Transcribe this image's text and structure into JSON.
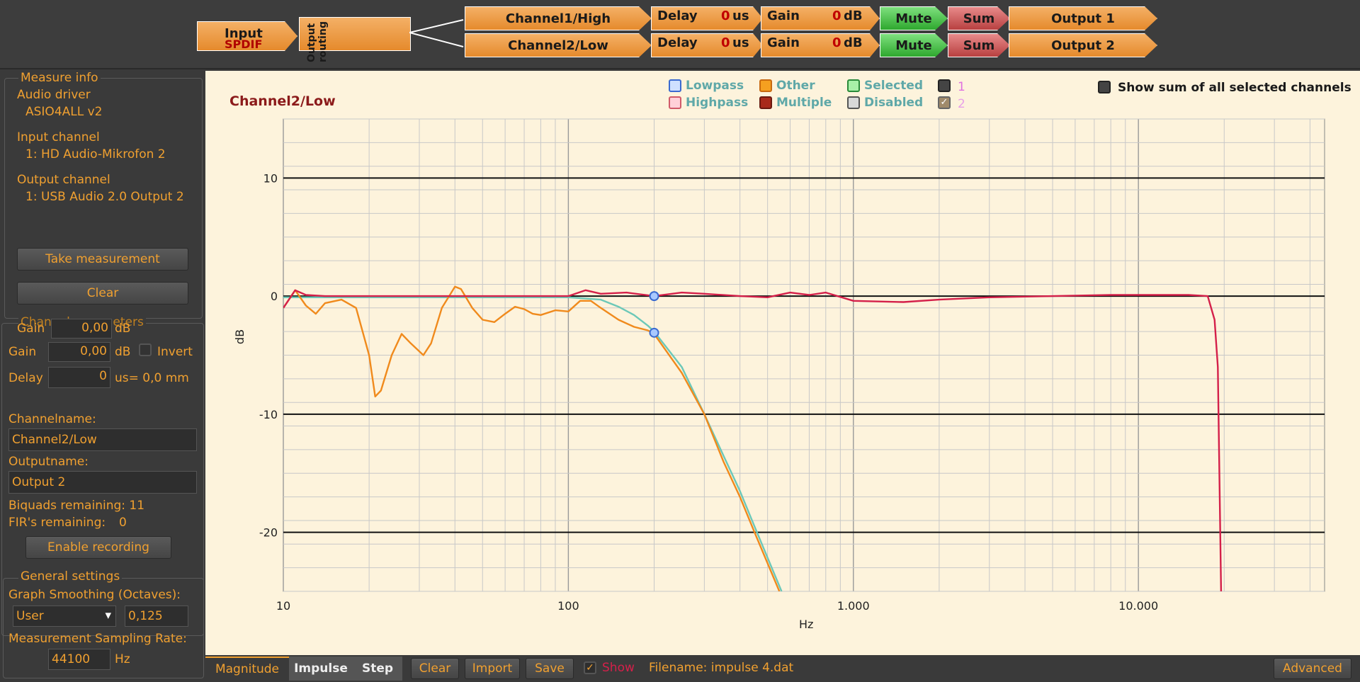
{
  "routing": {
    "input": "Input",
    "input_sub": "SPDIF",
    "output_routing": "Output routing",
    "channels": [
      {
        "name": "Channel1/High",
        "delay_label": "Delay",
        "delay_value": "0",
        "delay_unit": "us",
        "gain_label": "Gain",
        "gain_value": "0",
        "gain_unit": "dB",
        "mute": "Mute",
        "sum": "Sum",
        "output": "Output 1"
      },
      {
        "name": "Channel2/Low",
        "delay_label": "Delay",
        "delay_value": "0",
        "delay_unit": "us",
        "gain_label": "Gain",
        "gain_value": "0",
        "gain_unit": "dB",
        "mute": "Mute",
        "sum": "Sum",
        "output": "Output 2"
      }
    ]
  },
  "measure": {
    "title": "Measure info",
    "driver_label": "Audio driver",
    "driver_value": "ASIO4ALL v2",
    "input_label": "Input channel",
    "input_value": "1: HD Audio-Mikrofon 2",
    "output_label": "Output channel",
    "output_value": "1: USB Audio 2.0 Output 2",
    "take": "Take measurement",
    "clear": "Clear"
  },
  "channel_params": {
    "title": "Channel parameters",
    "gain_label": "Gain",
    "gain_value1": "0,00",
    "gain_value2": "0,00",
    "db": "dB",
    "invert": "Invert",
    "delay_label": "Delay",
    "delay_value": "0",
    "delay_unit": "us= 0,0 mm",
    "channelname_label": "Channelname:",
    "channelname": "Channel2/Low",
    "outputname_label": "Outputname:",
    "outputname": "Output 2",
    "biquads": "Biquads remaining: 11",
    "firs_label": "FIR's remaining:",
    "firs_value": "0",
    "enable_recording": "Enable recording"
  },
  "general": {
    "title": "General settings",
    "smoothing_label": "Graph Smoothing (Octaves):",
    "smoothing_select": "User",
    "smoothing_value": "0,125",
    "rate_label": "Measurement Sampling Rate:",
    "rate_value": "44100",
    "rate_unit": "Hz"
  },
  "legend": {
    "lowpass": "Lowpass",
    "highpass": "Highpass",
    "other": "Other",
    "multiple": "Multiple",
    "selected": "Selected",
    "disabled": "Disabled",
    "one": "1",
    "two": "2",
    "show_sum": "Show sum of all selected channels"
  },
  "colors": {
    "orange": "#f0a030",
    "red_curve": "#d4204a",
    "orange_curve": "#f08a1c",
    "teal_curve": "#6cc8b8"
  },
  "bottom": {
    "magnitude": "Magnitude",
    "impulse": "Impulse",
    "step": "Step",
    "clear": "Clear",
    "import": "Import",
    "save": "Save",
    "show": "Show",
    "filename": "Filename: impulse 4.dat",
    "advanced": "Advanced"
  },
  "chart_data": {
    "type": "line",
    "title": "Channel2/Low",
    "xlabel": "Hz",
    "ylabel": "dB",
    "xscale": "log",
    "xlim": [
      10,
      45000
    ],
    "ylim": [
      -25,
      15
    ],
    "xticks": [
      {
        "v": 10,
        "label": "10"
      },
      {
        "v": 100,
        "label": "100"
      },
      {
        "v": 1000,
        "label": "1.000"
      },
      {
        "v": 10000,
        "label": "10.000"
      }
    ],
    "yticks": [
      {
        "v": 10,
        "label": "10"
      },
      {
        "v": 0,
        "label": "0"
      },
      {
        "v": -10,
        "label": "-10"
      },
      {
        "v": -20,
        "label": "-20"
      }
    ],
    "series": [
      {
        "color": "#d4204a",
        "points": [
          [
            10,
            -1
          ],
          [
            11,
            0.5
          ],
          [
            12,
            0.1
          ],
          [
            14,
            0
          ],
          [
            30,
            0
          ],
          [
            100,
            0
          ],
          [
            115,
            0.5
          ],
          [
            130,
            0.2
          ],
          [
            160,
            0.3
          ],
          [
            200,
            0
          ],
          [
            250,
            0.3
          ],
          [
            300,
            0.2
          ],
          [
            400,
            0
          ],
          [
            500,
            -0.1
          ],
          [
            600,
            0.3
          ],
          [
            700,
            0.1
          ],
          [
            800,
            0.3
          ],
          [
            1000,
            -0.4
          ],
          [
            1500,
            -0.5
          ],
          [
            2000,
            -0.3
          ],
          [
            3000,
            -0.1
          ],
          [
            5000,
            0
          ],
          [
            8000,
            0.1
          ],
          [
            15000,
            0.1
          ],
          [
            17500,
            0
          ],
          [
            18500,
            -2
          ],
          [
            19000,
            -6
          ],
          [
            19500,
            -25
          ]
        ]
      },
      {
        "color": "#f08a1c",
        "points": [
          [
            10,
            -1
          ],
          [
            11,
            0.5
          ],
          [
            12,
            -0.8
          ],
          [
            13,
            -1.5
          ],
          [
            14,
            -0.6
          ],
          [
            16,
            -0.3
          ],
          [
            18,
            -1
          ],
          [
            20,
            -5
          ],
          [
            21,
            -8.5
          ],
          [
            22,
            -8
          ],
          [
            24,
            -5
          ],
          [
            26,
            -3.2
          ],
          [
            28,
            -4
          ],
          [
            31,
            -5
          ],
          [
            33,
            -4
          ],
          [
            36,
            -1
          ],
          [
            40,
            0.8
          ],
          [
            42,
            0.6
          ],
          [
            46,
            -1
          ],
          [
            50,
            -2
          ],
          [
            55,
            -2.2
          ],
          [
            60,
            -1.5
          ],
          [
            65,
            -0.9
          ],
          [
            70,
            -1.1
          ],
          [
            75,
            -1.5
          ],
          [
            80,
            -1.6
          ],
          [
            90,
            -1.2
          ],
          [
            100,
            -1.3
          ],
          [
            110,
            -0.4
          ],
          [
            120,
            -0.4
          ],
          [
            130,
            -1
          ],
          [
            150,
            -2
          ],
          [
            170,
            -2.6
          ],
          [
            190,
            -2.9
          ],
          [
            200,
            -3.2
          ],
          [
            250,
            -6.5
          ],
          [
            300,
            -10
          ],
          [
            350,
            -14
          ],
          [
            400,
            -17
          ],
          [
            450,
            -20
          ],
          [
            550,
            -25
          ]
        ]
      },
      {
        "color": "#6cc8b8",
        "points": [
          [
            10,
            -0.1
          ],
          [
            100,
            -0.1
          ],
          [
            130,
            -0.3
          ],
          [
            150,
            -0.9
          ],
          [
            170,
            -1.6
          ],
          [
            190,
            -2.5
          ],
          [
            200,
            -3
          ],
          [
            250,
            -6
          ],
          [
            300,
            -10
          ],
          [
            350,
            -13.5
          ],
          [
            400,
            -16.5
          ],
          [
            450,
            -19.5
          ],
          [
            560,
            -25
          ]
        ]
      }
    ],
    "markers": [
      [
        200,
        0
      ],
      [
        200,
        -3.1
      ]
    ]
  }
}
